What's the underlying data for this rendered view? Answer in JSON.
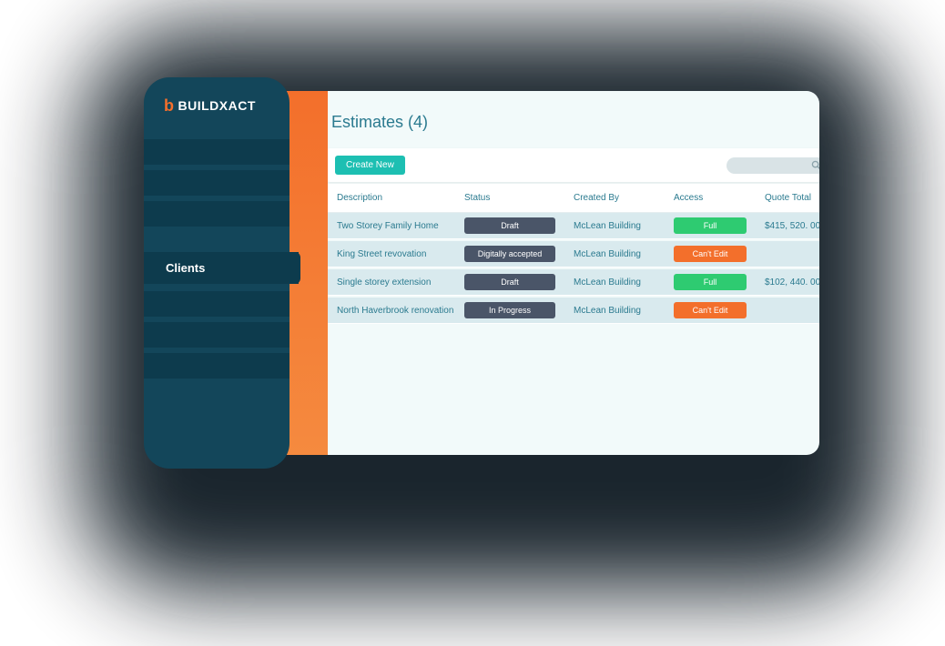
{
  "logo": {
    "text": "BUILDXACT"
  },
  "sidebar": {
    "active_label": "Clients"
  },
  "page": {
    "title": "Estimates (4)"
  },
  "toolbar": {
    "create_label": "Create New"
  },
  "columns": {
    "description": "Description",
    "status": "Status",
    "created_by": "Created By",
    "access": "Access",
    "quote_total": "Quote Total"
  },
  "rows": [
    {
      "description": "Two Storey Family Home",
      "status": "Draft",
      "created_by": "McLean Building",
      "access": "Full",
      "access_class": "full",
      "quote_total": "$415, 520. 00"
    },
    {
      "description": "King Street revovation",
      "status": "Digitally accepted",
      "created_by": "McLean Building",
      "access": "Can't Edit",
      "access_class": "cant",
      "quote_total": ""
    },
    {
      "description": "Single storey extension",
      "status": "Draft",
      "created_by": "McLean Building",
      "access": "Full",
      "access_class": "full",
      "quote_total": "$102, 440. 00"
    },
    {
      "description": "North Haverbrook renovation",
      "status": "In Progress",
      "created_by": "McLean Building",
      "access": "Can't Edit",
      "access_class": "cant",
      "quote_total": ""
    }
  ]
}
